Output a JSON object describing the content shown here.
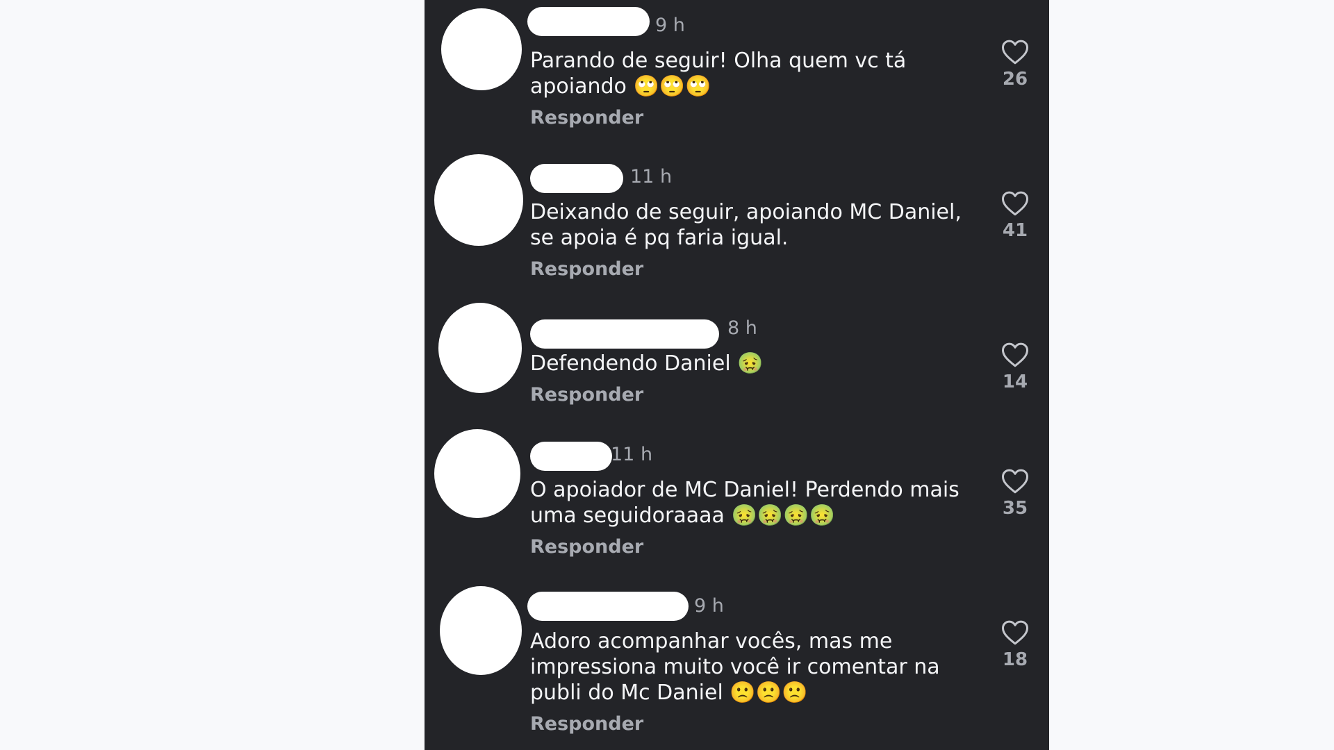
{
  "comments": [
    {
      "time": "9 h",
      "text": "Parando de seguir! Olha quem vc tá apoiando 🙄🙄🙄",
      "reply": "Responder",
      "likes": "26"
    },
    {
      "time": "11 h",
      "text": "Deixando de seguir, apoiando MC Daniel, se apoia é pq faria igual.",
      "reply": "Responder",
      "likes": "41"
    },
    {
      "time": "8 h",
      "text": "Defendendo Daniel 🤢",
      "reply": "Responder",
      "likes": "14"
    },
    {
      "time": "11 h",
      "text": "O apoiador de MC Daniel! Perdendo mais uma seguidoraaaa 🤢🤢🤢🤢",
      "reply": "Responder",
      "likes": "35"
    },
    {
      "time": "9 h",
      "text": "Adoro acompanhar vocês, mas me impressiona muito você ir comentar na publi do Mc Daniel 🙁🙁🙁",
      "reply": "Responder",
      "likes": "18"
    }
  ],
  "icons": {
    "like": "heart-icon",
    "avatar": "redacted-avatar"
  },
  "colors": {
    "background": "#232428",
    "text": "#f4f5f7",
    "muted": "#a7aab1",
    "redaction": "#ffffff"
  }
}
